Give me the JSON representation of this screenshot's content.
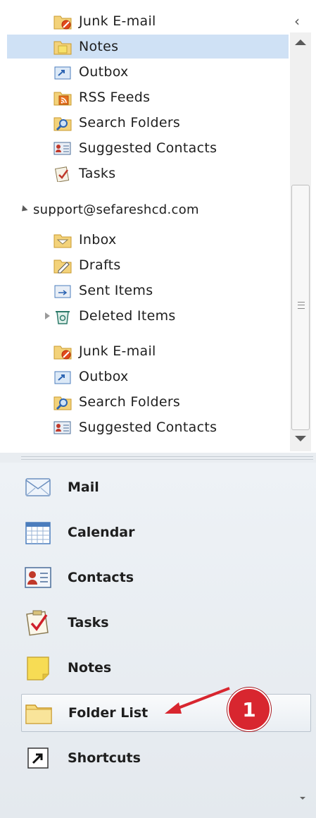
{
  "folders_top": [
    {
      "label": "Junk E-mail",
      "icon": "junk-folder-icon"
    },
    {
      "label": "Notes",
      "icon": "notes-folder-icon",
      "selected": true
    },
    {
      "label": "Outbox",
      "icon": "outbox-folder-icon"
    },
    {
      "label": "RSS Feeds",
      "icon": "rss-folder-icon"
    },
    {
      "label": "Search Folders",
      "icon": "search-folder-icon"
    },
    {
      "label": "Suggested Contacts",
      "icon": "contacts-folder-icon"
    },
    {
      "label": "Tasks",
      "icon": "tasks-folder-icon"
    }
  ],
  "account": {
    "label": "support@sefareshcd.com"
  },
  "folders_account": [
    {
      "label": "Inbox",
      "icon": "inbox-folder-icon"
    },
    {
      "label": "Drafts",
      "icon": "drafts-folder-icon"
    },
    {
      "label": "Sent Items",
      "icon": "sent-folder-icon"
    },
    {
      "label": "Deleted Items",
      "icon": "deleted-folder-icon"
    },
    {
      "label": "Junk E-mail",
      "icon": "junk-folder-icon"
    },
    {
      "label": "Outbox",
      "icon": "outbox-folder-icon"
    },
    {
      "label": "Search Folders",
      "icon": "search-folder-icon"
    },
    {
      "label": "Suggested Contacts",
      "icon": "contacts-folder-icon"
    }
  ],
  "nav": [
    {
      "label": "Mail",
      "icon": "mail-icon"
    },
    {
      "label": "Calendar",
      "icon": "calendar-icon"
    },
    {
      "label": "Contacts",
      "icon": "contacts-icon"
    },
    {
      "label": "Tasks",
      "icon": "tasks-icon"
    },
    {
      "label": "Notes",
      "icon": "notes-icon"
    },
    {
      "label": "Folder List",
      "icon": "folder-list-icon",
      "active": true
    },
    {
      "label": "Shortcuts",
      "icon": "shortcuts-icon"
    }
  ],
  "callout": {
    "number": "1"
  },
  "colors": {
    "selected_row": "#cfe1f5",
    "callout": "#d8262f",
    "arrow": "#d8262f"
  }
}
